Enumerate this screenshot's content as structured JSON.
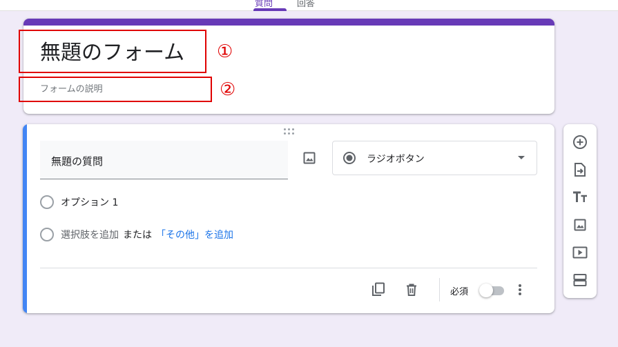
{
  "tabs": [
    {
      "label": "質問",
      "active": true
    },
    {
      "label": "回答",
      "active": false
    }
  ],
  "form": {
    "title": "無題のフォーム",
    "description_placeholder": "フォームの説明"
  },
  "annotations": {
    "marker_1": "①",
    "marker_2": "②"
  },
  "question": {
    "title": "無題の質問",
    "type_label": "ラジオボタン",
    "options": [
      {
        "label": "オプション 1"
      }
    ],
    "add_option": {
      "label": "選択肢を追加",
      "or_label": "または",
      "other_label": "「その他」を追加"
    },
    "required_label": "必須",
    "required": false
  },
  "icons": {
    "image": "image-icon",
    "radio": "radio-button-checked-icon",
    "dropdown": "arrow-drop-down-icon",
    "copy": "content-copy-icon",
    "delete": "trash-icon",
    "more": "more-vert-icon",
    "toolbar": [
      "add-circle-icon",
      "import-question-icon",
      "title-text-icon",
      "image-icon",
      "video-icon",
      "section-icon"
    ]
  },
  "colors": {
    "theme": "#673ab7",
    "background": "#f0ebf8",
    "active_accent": "#4285f4",
    "link": "#1a73e8",
    "annotation": "#e00000"
  }
}
